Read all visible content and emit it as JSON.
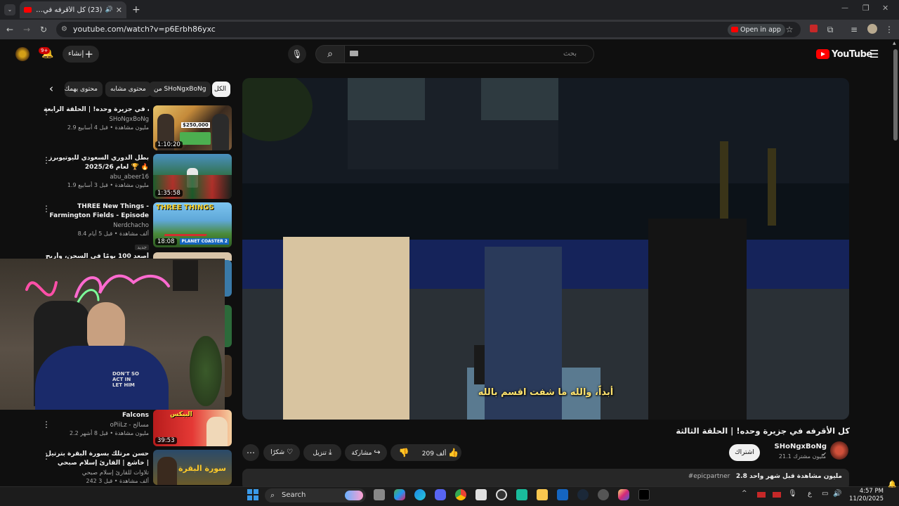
{
  "browser": {
    "tab_title": "(23) كل الأقرفه في جزيرة وحد",
    "url": "youtube.com/watch?v=p6Erbh86yxc",
    "open_in_app": "Open in app"
  },
  "masthead": {
    "logo_text": "YouTube",
    "search_placeholder": "بحث",
    "create_label": "إنشاء",
    "notification_count": "9+"
  },
  "chips": [
    "الكل",
    "من SHoNgxBoNg",
    "محتوى مشابه",
    "محتوى يهمك"
  ],
  "sidebar_videos": [
    {
      "title": "كل الأقرفه في جزيرة وحده! | الحلقة الرابعة",
      "channel": "SHoNgxBoNg",
      "stats": "2.9 مليون مشاهدة • قبل 4 أسابيع",
      "duration": "1:10:20"
    },
    {
      "title": "بطل الدوري السعودي لليوتيوبرز لعام 2025/26 🏆 🔥",
      "channel": "abu_abeer16",
      "stats": "1.9 مليون مشاهدة • قبل 3 أسابيع",
      "duration": "1:35:58"
    },
    {
      "title": "THREE New Things - Farmington Fields - Episode 21 -",
      "channel": "Nerdchacho",
      "stats": "8.4 ألف مشاهدة • قبل 5 أيام",
      "duration": "18:08",
      "badge": "جديد"
    },
    {
      "title": "أصعد 100 يومًا في السجن، وأربح",
      "channel": "",
      "stats": "",
      "duration": ""
    },
    {
      "title": "Falcons",
      "channel": "oPiiLz - مسالح",
      "stats": "2.2 مليون مشاهدة • قبل 8 أشهر",
      "duration": "39:53"
    },
    {
      "title": "حسن مرتلك بسورة البقرة بترتيل خاشع | القارئ إسلام صبحي | Surah Al-Baqara",
      "channel": "تلاوات للقارئ إسلام صبحي",
      "stats": "242 ألف مشاهدة • قبل 3",
      "duration": ""
    }
  ],
  "player": {
    "subtitle": "أبداً، والله ما شفت اقسم بالله"
  },
  "video": {
    "title": "كل الأقرفه في جزيرة وحده! | الحلقة الثالثة",
    "channel": "SHoNgxBoNg",
    "subscribers": "21.1 مليون مشترك",
    "subscribe_label": "اشتراك",
    "likes": "209 ألف",
    "share_label": "مشاركة",
    "download_label": "تنزيل",
    "thanks_label": "شكرًا",
    "views_line": "2.8 مليون مشاهدة  قبل شهر واحد",
    "hashtag": "#epicpartner"
  },
  "taskbar": {
    "search_label": "Search",
    "time": "4:57 PM",
    "date": "11/20/2025",
    "lang": "ع"
  }
}
